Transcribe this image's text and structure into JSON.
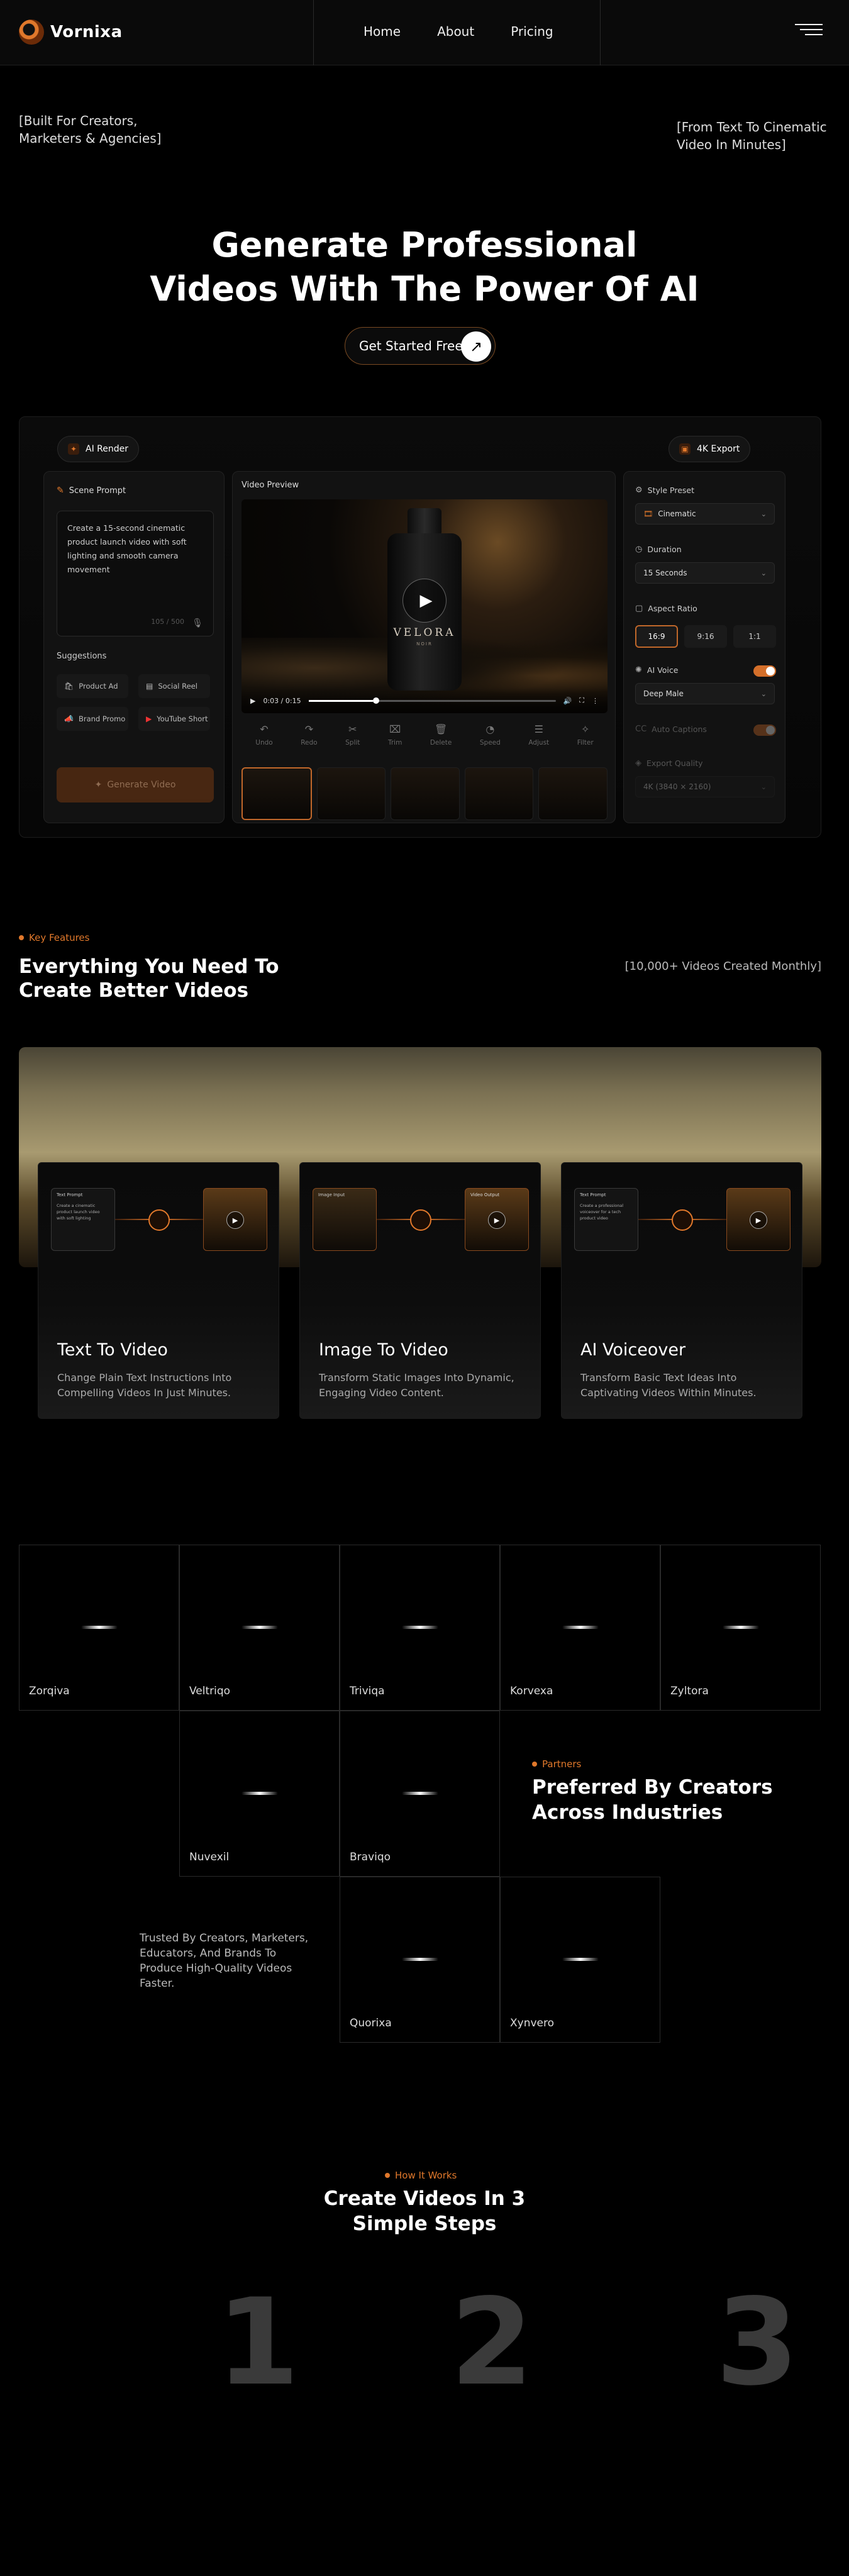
{
  "nav": {
    "brand": "Vornixa",
    "links": [
      "Home",
      "About",
      "Pricing"
    ]
  },
  "hero": {
    "left_tag": "[Built For Creators, Marketers & Agencies]",
    "right_tag": "[From Text To Cinematic Video In Minutes]",
    "title_line1": "Generate Professional",
    "title_line2": "Videos With The Power Of AI",
    "cta": "Get Started Free"
  },
  "editor": {
    "badge_left": "AI Render",
    "badge_right": "4K Export",
    "prompt_title": "Scene Prompt",
    "prompt_text": "Create a 15-second cinematic product launch video with soft lighting and smooth camera movement",
    "char_count": "105 / 500",
    "suggestions_title": "Suggestions",
    "suggestions": [
      "Product Ad",
      "Social Reel",
      "Brand Promo",
      "YouTube Short"
    ],
    "generate": "Generate Video",
    "preview_title": "Video Preview",
    "product_name": "VELORA",
    "product_sub": "NOIR",
    "time": "0:03 / 0:15",
    "tools": [
      "Undo",
      "Redo",
      "Split",
      "Trim",
      "Delete",
      "Speed",
      "Adjust",
      "Filter"
    ],
    "style_title": "Style Preset",
    "style_value": "Cinematic",
    "duration_title": "Duration",
    "duration_value": "15 Seconds",
    "aspect_title": "Aspect Ratio",
    "aspects": [
      "16:9",
      "9:16",
      "1:1"
    ],
    "voice_title": "AI Voice",
    "voice_value": "Deep Male",
    "captions_title": "Auto Captions",
    "quality_title": "Export Quality",
    "quality_value": "4K (3840 × 2160)"
  },
  "features": {
    "kicker": "Key Features",
    "title_line1": "Everything You Need To",
    "title_line2": "Create Better Videos",
    "stat": "[10,000+ Videos Created Monthly]",
    "cards": [
      {
        "title": "Text To Video",
        "desc": "Change Plain Text Instructions Into Compelling Videos In Just Minutes.",
        "in_label": "Text Prompt",
        "in_text": "Create a cinematic product launch video with soft lighting"
      },
      {
        "title": "Image To Video",
        "desc": "Transform Static Images Into Dynamic, Engaging Video Content.",
        "in_label": "Image Input",
        "out_label": "Video Output"
      },
      {
        "title": "AI Voiceover",
        "desc": "Transform Basic Text Ideas Into Captivating Videos Within Minutes.",
        "in_label": "Text Prompt",
        "in_text": "Create a professional voiceover for a tech product video"
      }
    ]
  },
  "partners": {
    "kicker": "Partners",
    "title_line1": "Preferred By Creators",
    "title_line2": "Across Industries",
    "trusted": "Trusted By Creators, Marketers, Educators, And Brands To Produce High-Quality Videos Faster.",
    "names": [
      "Zorqiva",
      "Veltriqo",
      "Triviqa",
      "Korvexa",
      "Zyltora",
      "Nuvexil",
      "Braviqo",
      "Quorixa",
      "Xynvero"
    ]
  },
  "how": {
    "kicker": "How It Works",
    "title_line1": "Create Videos In 3",
    "title_line2": "Simple Steps",
    "steps": [
      "1",
      "2",
      "3"
    ]
  },
  "colors": {
    "accent": "#E0782B",
    "background": "#000000"
  }
}
